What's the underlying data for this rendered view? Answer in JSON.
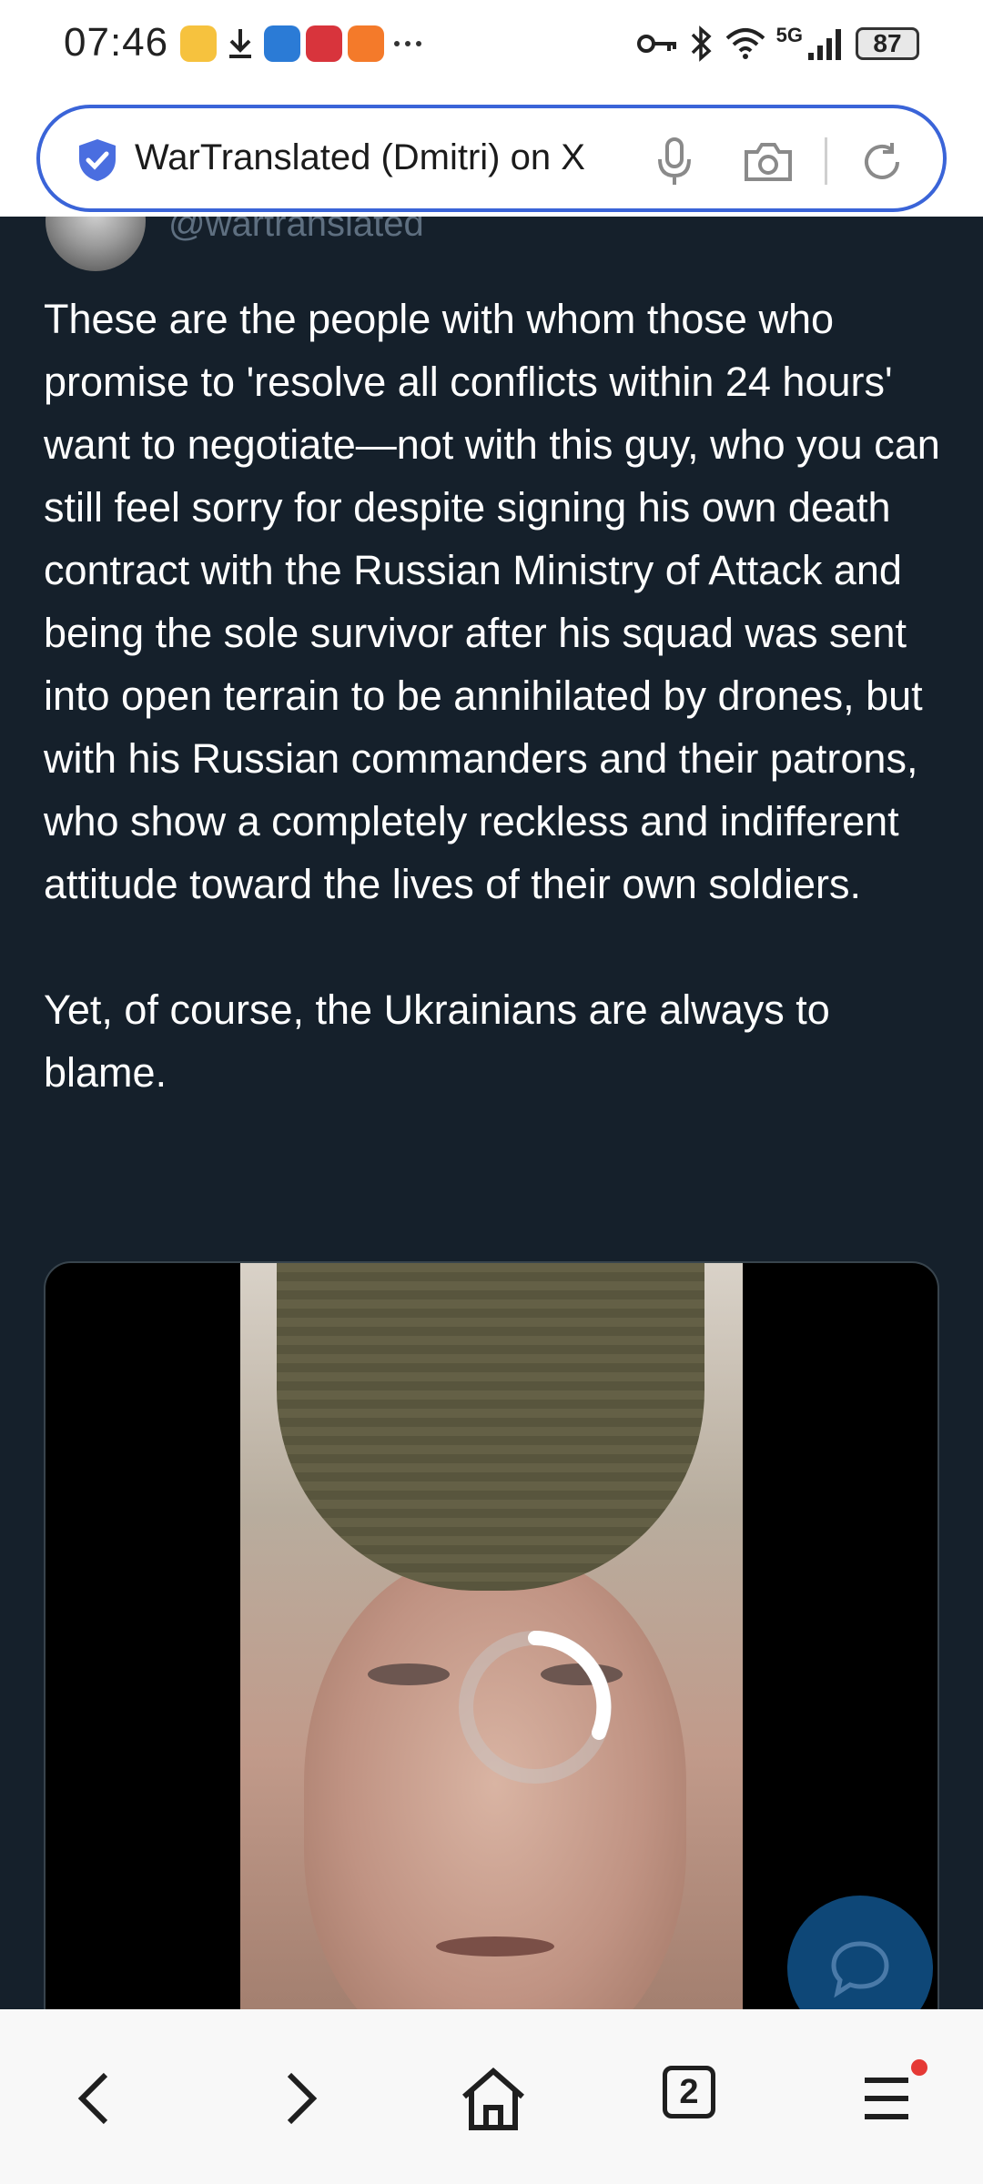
{
  "status_bar": {
    "time": "07:46",
    "network": "5G",
    "battery": "87"
  },
  "browser": {
    "url_text": "WarTranslated (Dmitri) on X",
    "open_tabs": "2"
  },
  "tweet": {
    "handle": "@wartranslated",
    "text": "These are the people with whom those who promise to 'resolve all conflicts within 24 hours' want to negotiate—not with this guy, who you can still feel sorry for despite signing his own death contract with the Russian Ministry of Attack and being the sole survivor after his squad was sent into open terrain to be annihilated by drones, but with his Russian commanders and their patrons, who show a completely reckless and indifferent attitude toward the lives of their own soldiers.\n\nYet, of course, the Ukrainians are always to blame."
  },
  "colors": {
    "accent": "#3a64d8",
    "timeline_bg": "#15202b",
    "fab": "#0e4777",
    "notification": "#e53935"
  },
  "icons": {
    "status": [
      "weibo-icon",
      "download-icon",
      "bird-app-icon",
      "gift-app-icon",
      "play-app-icon",
      "more-icon",
      "key-icon",
      "bluetooth-icon",
      "wifi-icon",
      "signal-icon",
      "battery-icon"
    ],
    "x_tabs": [
      "home-icon",
      "search-icon",
      "grok-icon",
      "notifications-icon",
      "messages-icon",
      "communities-icon"
    ],
    "browser_nav": [
      "back-icon",
      "forward-icon",
      "home-icon",
      "tabs-icon",
      "menu-icon"
    ]
  }
}
